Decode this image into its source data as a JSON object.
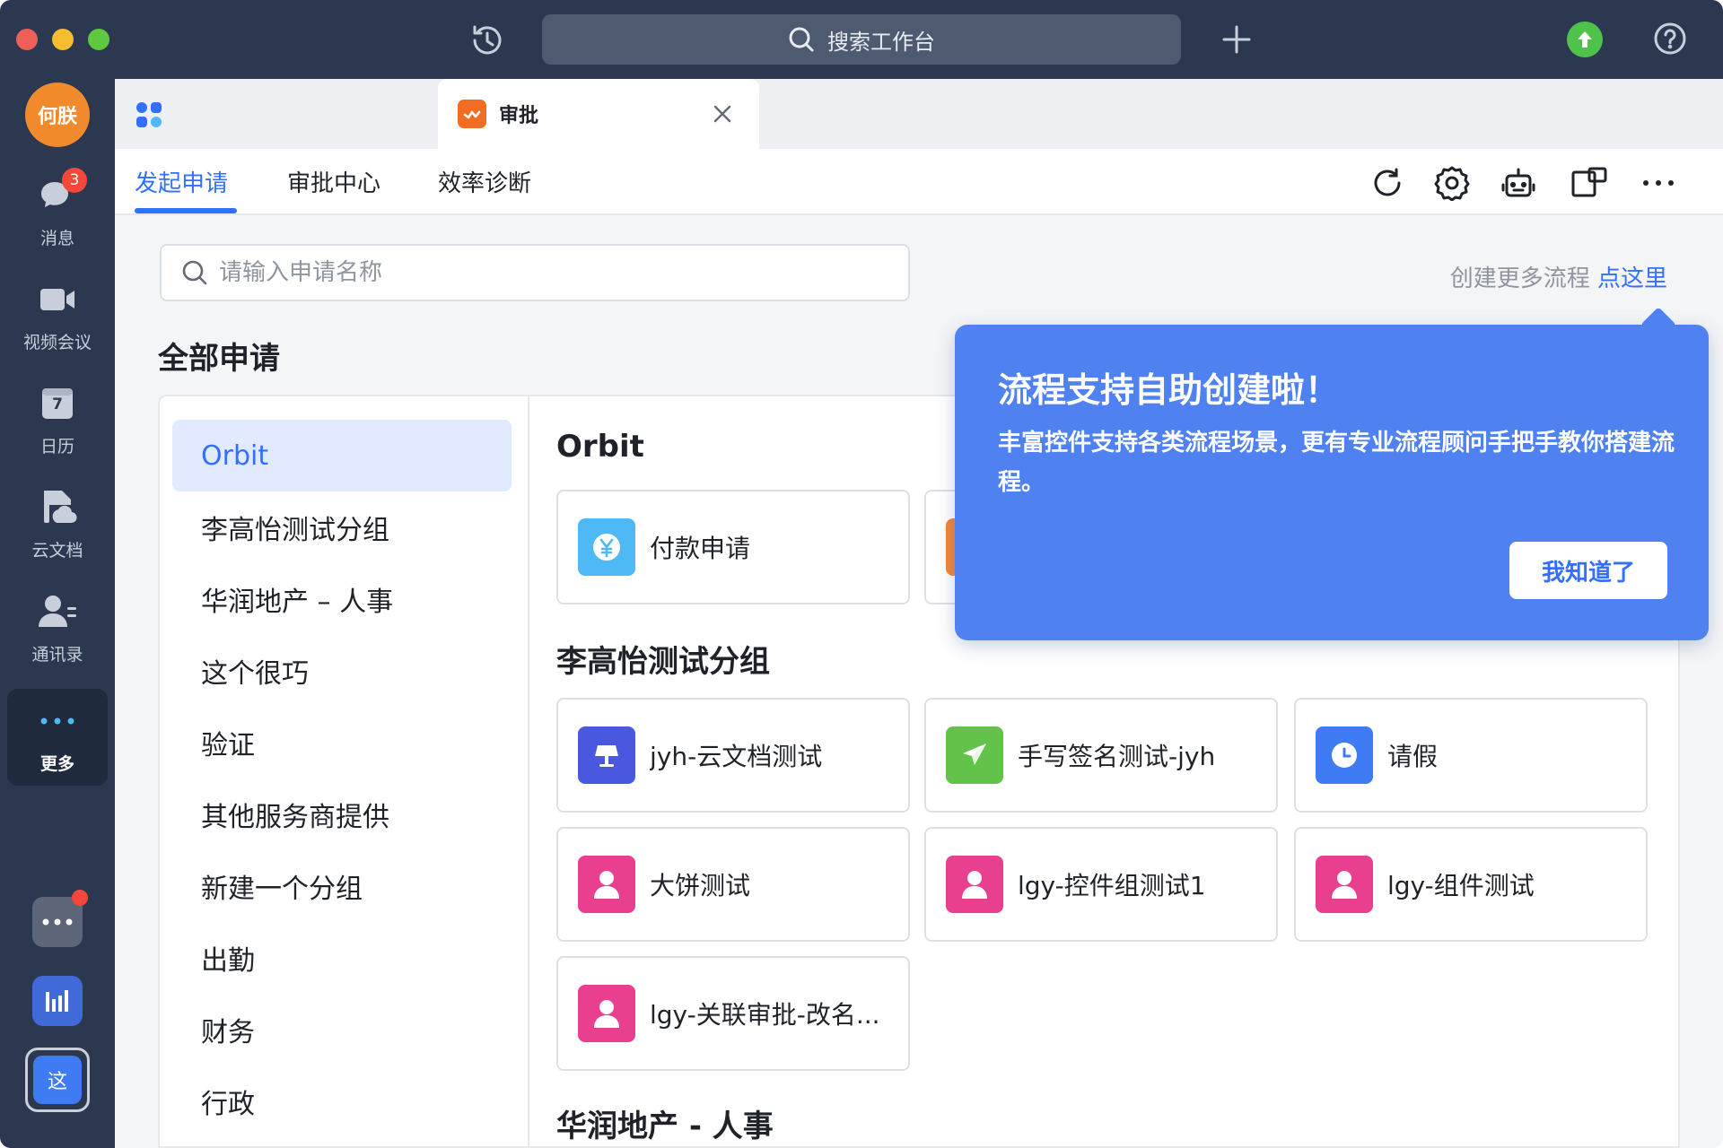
{
  "titlebar": {
    "search_placeholder": "搜索工作台"
  },
  "rail": {
    "avatar_text": "何朕",
    "items": [
      {
        "label": "消息",
        "badge": "3"
      },
      {
        "label": "视频会议"
      },
      {
        "label": "日历",
        "calendar_day": "7"
      },
      {
        "label": "云文档"
      },
      {
        "label": "通讯录"
      },
      {
        "label": "更多"
      }
    ],
    "current_app_text": "这"
  },
  "tabstrip": {
    "active_tab_label": "审批"
  },
  "subnav": {
    "tabs": [
      {
        "label": "发起申请",
        "active": true
      },
      {
        "label": "审批中心"
      },
      {
        "label": "效率诊断"
      }
    ]
  },
  "main": {
    "search_placeholder": "请输入申请名称",
    "create_hint": "创建更多流程",
    "create_link": "点这里",
    "section_heading": "全部申请",
    "groups": [
      {
        "label": "Orbit",
        "active": true
      },
      {
        "label": "李高怡测试分组"
      },
      {
        "label": "华润地产 – 人事"
      },
      {
        "label": "这个很巧"
      },
      {
        "label": "验证"
      },
      {
        "label": "其他服务商提供"
      },
      {
        "label": "新建一个分组"
      },
      {
        "label": "出勤"
      },
      {
        "label": "财务"
      },
      {
        "label": "行政"
      }
    ],
    "card_groups": [
      {
        "title": "Orbit",
        "cards": [
          {
            "label": "付款申请",
            "icon": "yen-icon",
            "color": "#4fb9f5"
          },
          {
            "label": "",
            "icon": "partial-icon",
            "color": "#f0883a"
          }
        ]
      },
      {
        "title": "李高怡测试分组",
        "cards": [
          {
            "label": "jyh-云文档测试",
            "icon": "lamp-icon",
            "color": "#4a58e0"
          },
          {
            "label": "手写签名测试-jyh",
            "icon": "plane-icon",
            "color": "#62c24a"
          },
          {
            "label": "请假",
            "icon": "clock-icon",
            "color": "#3f7cf4"
          },
          {
            "label": "大饼测试",
            "icon": "person-icon",
            "color": "#e83f8f"
          },
          {
            "label": "lgy-控件组测试1",
            "icon": "person-icon",
            "color": "#e83f8f"
          },
          {
            "label": "lgy-组件测试",
            "icon": "person-icon",
            "color": "#e83f8f"
          },
          {
            "label": "lgy-关联审批-改名...",
            "icon": "person-icon",
            "color": "#e83f8f"
          }
        ]
      },
      {
        "title": "华润地产 - 人事",
        "cards": []
      }
    ]
  },
  "popover": {
    "title": "流程支持自助创建啦！",
    "body": "丰富控件支持各类流程场景，更有专业流程顾问手把手教你搭建流程。",
    "button": "我知道了"
  },
  "colors": {
    "accent": "#3370ff",
    "sidebar_bg": "#2b3850",
    "popover_bg": "#4f82f0"
  }
}
